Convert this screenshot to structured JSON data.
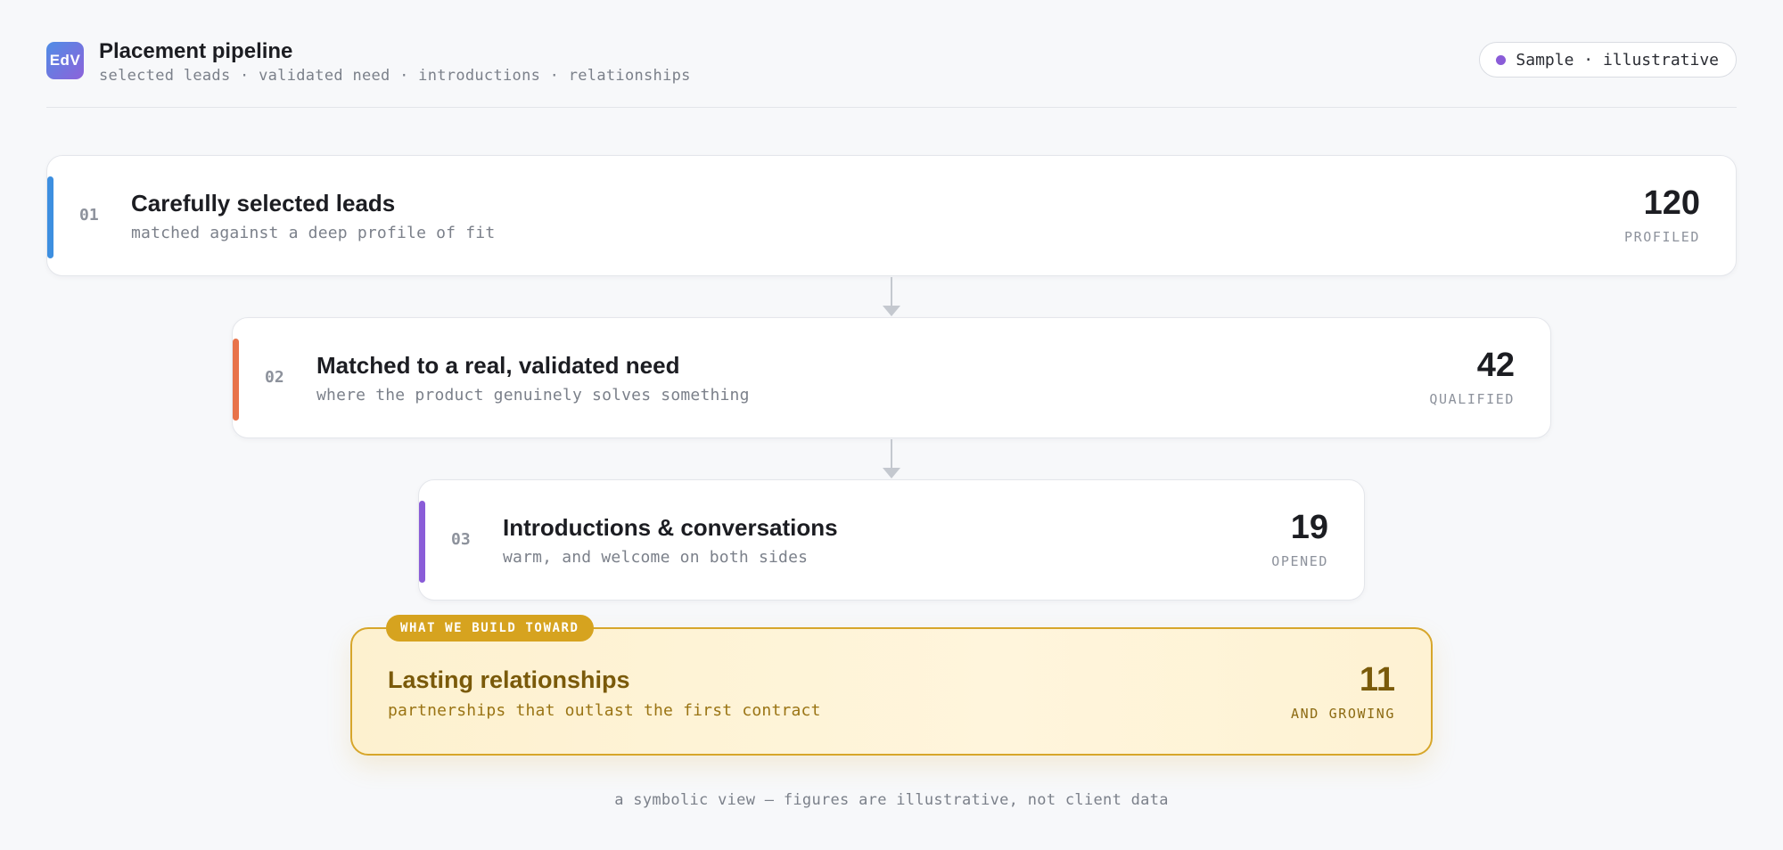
{
  "header": {
    "logo_text": "EdV",
    "title": "Placement pipeline",
    "subtitle": "selected leads · validated need · introductions · relationships",
    "badge_label": "Sample · illustrative",
    "badge_dot_color": "#8a5cd8"
  },
  "stages": [
    {
      "number": "01",
      "title": "Carefully selected leads",
      "description": "matched against a deep profile of fit",
      "value": "120",
      "unit": "PROFILED",
      "accent_color": "#3d8fe0"
    },
    {
      "number": "02",
      "title": "Matched to a real, validated need",
      "description": "where the product genuinely solves something",
      "value": "42",
      "unit": "QUALIFIED",
      "accent_color": "#e8734a"
    },
    {
      "number": "03",
      "title": "Introductions & conversations",
      "description": "warm, and welcome on both sides",
      "value": "19",
      "unit": "OPENED",
      "accent_color": "#8a5cd8"
    }
  ],
  "goal": {
    "tag": "WHAT WE BUILD TOWARD",
    "title": "Lasting relationships",
    "description": "partnerships that outlast the first contract",
    "value": "11",
    "unit": "AND GROWING",
    "accent_color": "#d6a31f"
  },
  "footnote": "a symbolic view — figures are illustrative, not client data"
}
